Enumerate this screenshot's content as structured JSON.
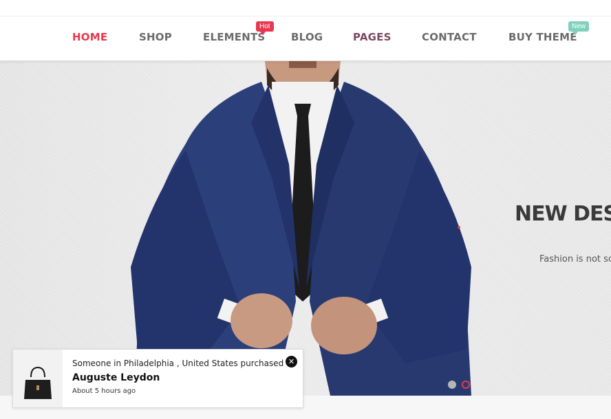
{
  "nav": {
    "items": [
      {
        "label": "HOME"
      },
      {
        "label": "SHOP"
      },
      {
        "label": "ELEMENTS"
      },
      {
        "label": "BLOG"
      },
      {
        "label": "PAGES"
      },
      {
        "label": "CONTACT"
      },
      {
        "label": "BUY THEME"
      }
    ],
    "badges": {
      "hot": "Hot",
      "new": "New"
    }
  },
  "hero": {
    "title": "NEW DES",
    "subtitle": "Fashion is not sc",
    "slide_count": 2,
    "active_slide": 2
  },
  "popup": {
    "message": "Someone in Philadelphia , United States purchased a",
    "product_name": "Auguste Leydon",
    "time_ago": "About 5 hours ago",
    "close_icon": "close-icon"
  },
  "colors": {
    "accent": "#e8384f",
    "nav_text": "#6b6b6b",
    "new_badge": "#7fd1bd",
    "suit": "#2b3f7a"
  }
}
